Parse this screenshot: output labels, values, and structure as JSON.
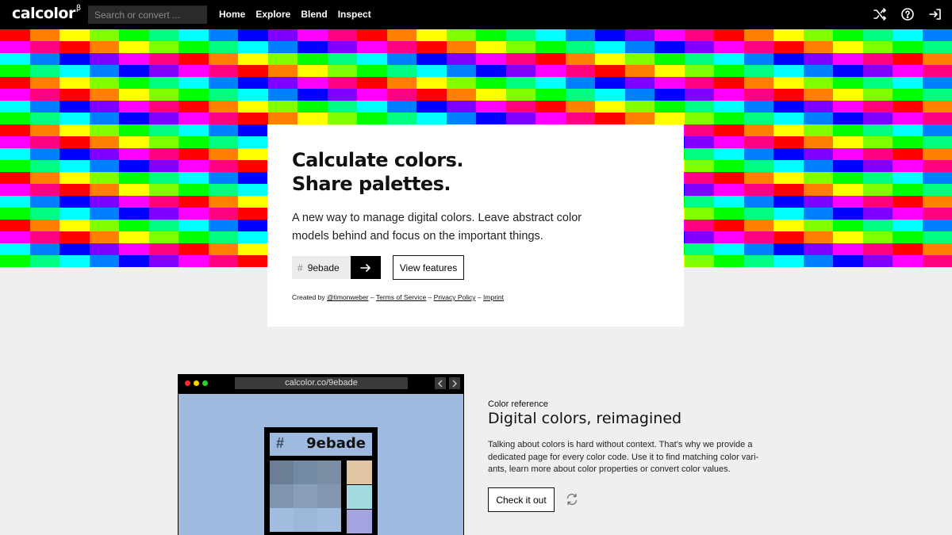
{
  "nav": {
    "logo": "calcolor",
    "logo_sup": "β",
    "search_placeholder": "Search or convert ...",
    "links": [
      "Home",
      "Explore",
      "Blend",
      "Inspect"
    ],
    "icons": [
      "shuffle-icon",
      "help-icon",
      "login-icon"
    ]
  },
  "mosaic": {
    "palette": [
      "#ff0000",
      "#ff8000",
      "#ffff00",
      "#80ff00",
      "#00ff00",
      "#00ff80",
      "#00ffff",
      "#0080ff",
      "#0000ff",
      "#8000ff",
      "#ff00ff",
      "#ff0080"
    ]
  },
  "hero": {
    "title_line1": "Calculate colors.",
    "title_line2": "Share palettes.",
    "description": "A new way to manage digital colors. Leave abstract color models behind and focus on the important things.",
    "hex_prefix": "#",
    "hex_value": "9ebade",
    "features_button": "View features",
    "credits_prefix": "Created by",
    "credits_author": "@timonweber",
    "sep": "–",
    "terms": "Terms of Service",
    "privacy": "Privacy Policy",
    "imprint": "Imprint"
  },
  "browser": {
    "url": "calcolor.co/9ebade",
    "hex_prefix": "#",
    "hex_value": "9ebade",
    "base_color": "#9ebade",
    "shade_grid": [
      "#6b7e96",
      "#728aa3",
      "#7a8ea5",
      "#8094ae",
      "#899eb8",
      "#8497b0",
      "#a3bde0",
      "#9db7da",
      "#a2bcdf"
    ],
    "side_swatches": [
      "#e0c6a3",
      "#a3dbe0",
      "#a3a3e0"
    ]
  },
  "feature": {
    "label": "Color reference",
    "title": "Digital colors, reimagined",
    "description": "Talking about colors is hard without context. That’s why we provide a dedicated page for every color code. Use it to find matching color vari­ants, learn more about color properties or convert color values.",
    "button": "Check it out"
  }
}
